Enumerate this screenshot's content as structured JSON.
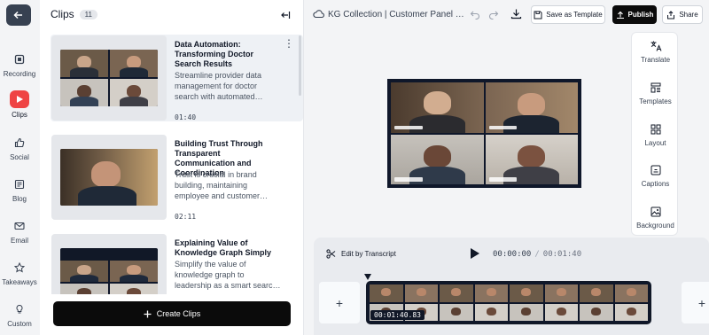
{
  "rail": {
    "items": [
      {
        "label": "Recording",
        "icon": "recording-icon"
      },
      {
        "label": "Clips",
        "icon": "clips-icon",
        "active": true
      },
      {
        "label": "Social",
        "icon": "thumbs-up-icon"
      },
      {
        "label": "Blog",
        "icon": "blog-icon"
      },
      {
        "label": "Email",
        "icon": "mail-icon"
      },
      {
        "label": "Takeaways",
        "icon": "star-icon"
      },
      {
        "label": "Custom",
        "icon": "lightbulb-icon"
      }
    ]
  },
  "clips": {
    "title": "Clips",
    "count": "11",
    "items": [
      {
        "title": "Data Automation: Transforming Doctor Search Results",
        "desc_line1": "Streamline provider data",
        "desc_line2": "management for doctor",
        "desc_line3": "search with automated…",
        "duration": "01:40"
      },
      {
        "title": "Building Trust Through Transparent Communication and Coordination",
        "desc_line1": "Trust is crucial in brand",
        "desc_line2": "building, maintaining",
        "desc_line3": "employee and customer…",
        "duration": "02:11"
      },
      {
        "title": "Explaining Value of Knowledge Graph Simply",
        "desc_line1": "Simplify the value of",
        "desc_line2": "knowledge graph to",
        "desc_line3": "leadership as a smart searc…",
        "duration": ""
      }
    ],
    "create_label": "Create Clips"
  },
  "topbar": {
    "doc_title": "KG Collection | Customer Panel …",
    "save_template_label": "Save as Template",
    "publish_label": "Publish",
    "share_label": "Share"
  },
  "tools": {
    "items": [
      {
        "label": "Translate",
        "icon": "translate-icon"
      },
      {
        "label": "Templates",
        "icon": "templates-icon"
      },
      {
        "label": "Layout",
        "icon": "layout-icon"
      },
      {
        "label": "Captions",
        "icon": "captions-icon"
      },
      {
        "label": "Background",
        "icon": "background-icon"
      }
    ]
  },
  "timeline": {
    "edit_label": "Edit by Transcript",
    "current_time": "00:00:00",
    "separator": "/",
    "total_time": "00:01:40",
    "strip_time": "00:01:40.83"
  },
  "colors": {
    "accent": "#ef4444",
    "primary_button": "#0b0b0b"
  }
}
